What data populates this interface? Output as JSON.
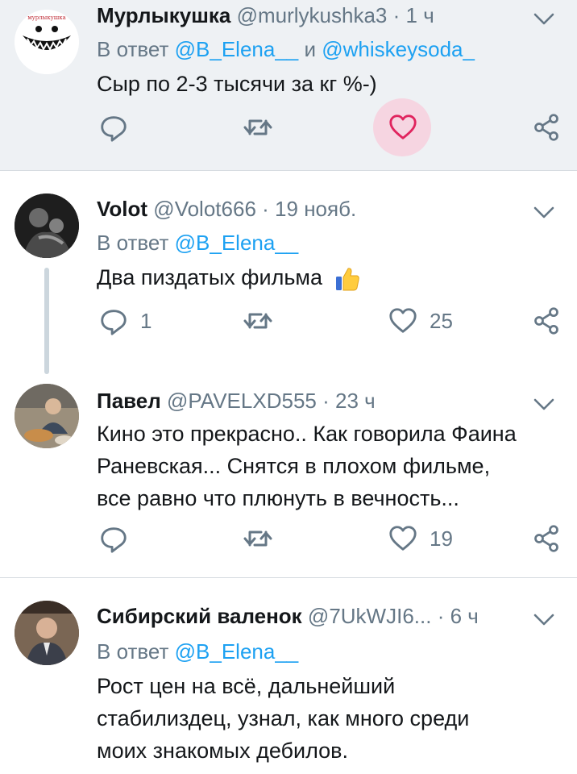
{
  "colors": {
    "accent": "#1da1f2",
    "muted": "#657786",
    "like": "#e0245e",
    "highlight_bg": "#eef1f4"
  },
  "tweets": [
    {
      "avatar_label": "мурлыкушка",
      "name": "Мурлыкушка",
      "handle": "@murlykushka3",
      "separator": "·",
      "time": "1 ч",
      "reply_prefix": "В ответ",
      "reply_to_1": "@B_Elena__",
      "reply_joiner": "и",
      "reply_to_2": "@whiskeysoda_",
      "text": "Сыр по 2-3 тысячи за кг %-)",
      "reply_count": "",
      "retweet_count": "",
      "like_count": "",
      "liked_highlight": true
    },
    {
      "name": "Volot",
      "handle": "@Volot666",
      "separator": "·",
      "time": "19 нояб.",
      "reply_prefix": "В ответ",
      "reply_to_1": "@B_Elena__",
      "text": "Два пиздатых фильма",
      "emoji": "thumbs-up",
      "reply_count": "1",
      "retweet_count": "",
      "like_count": "25"
    },
    {
      "name": "Павел",
      "handle": "@PAVELXD555",
      "separator": "·",
      "time": "23 ч",
      "text_lines": [
        "Кино это прекрасно.. Как говорила Фаина",
        "Раневская... Снятся в плохом фильме,",
        "все равно что плюнуть в вечность..."
      ],
      "reply_count": "",
      "retweet_count": "",
      "like_count": "19"
    },
    {
      "name": "Сибирский валенок",
      "handle": "@7UkWJI6...",
      "separator": "·",
      "time": "6 ч",
      "reply_prefix": "В ответ",
      "reply_to_1": "@B_Elena__",
      "text_lines": [
        "Рост цен на всё, дальнейший",
        "стабилиздец, узнал, как много среди",
        "моих знакомых дебилов."
      ]
    }
  ],
  "icons": {
    "reply": "reply-icon",
    "retweet": "retweet-icon",
    "like": "heart-icon",
    "share": "share-icon",
    "menu": "chevron-down-icon"
  }
}
